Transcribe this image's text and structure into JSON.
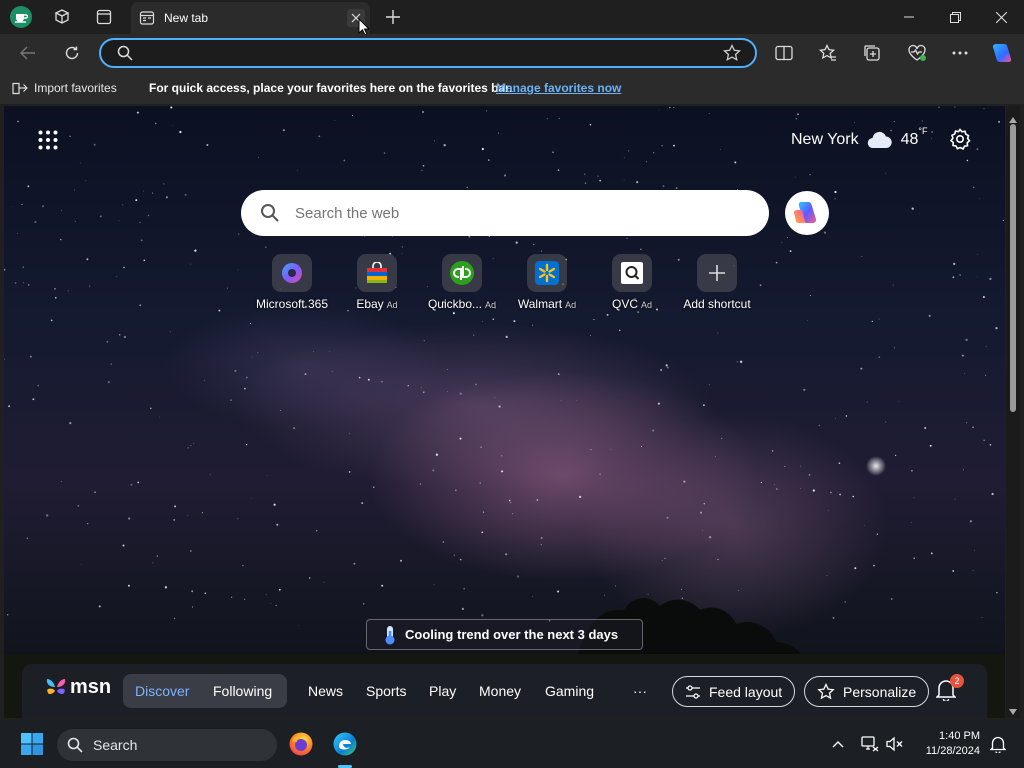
{
  "browser": {
    "tab": {
      "title": "New tab"
    },
    "address_bar": {
      "value": "",
      "placeholder": ""
    }
  },
  "favorites_bar": {
    "import_label": "Import favorites",
    "message": "For quick access, place your favorites here on the favorites bar.",
    "manage_link": "Manage favorites now"
  },
  "new_tab": {
    "weather": {
      "city": "New York",
      "temperature": "48",
      "unit": "°F"
    },
    "search": {
      "placeholder": "Search the web"
    },
    "shortcuts": [
      {
        "label": "Microsoft 365",
        "ad": ""
      },
      {
        "label": "Ebay",
        "ad": "Ad"
      },
      {
        "label": "Quickbo...",
        "ad": "Ad"
      },
      {
        "label": "Walmart",
        "ad": "Ad"
      },
      {
        "label": "QVC",
        "ad": "Ad"
      },
      {
        "label": "Add shortcut",
        "ad": ""
      }
    ],
    "weather_banner": "Cooling trend over the next 3 days",
    "msn": {
      "logo": "msn",
      "tabs": [
        "Discover",
        "Following"
      ],
      "nav": [
        "News",
        "Sports",
        "Play",
        "Money",
        "Gaming"
      ],
      "more": "···",
      "feed_layout": "Feed layout",
      "personalize": "Personalize",
      "notification_count": "2"
    }
  },
  "taskbar": {
    "search_label": "Search",
    "time": "1:40 PM",
    "date": "11/28/2024"
  },
  "colors": {
    "accent": "#4fb0ff",
    "link": "#6cb3f5",
    "discover": "#7cb3ff",
    "badge": "#e8523f"
  }
}
